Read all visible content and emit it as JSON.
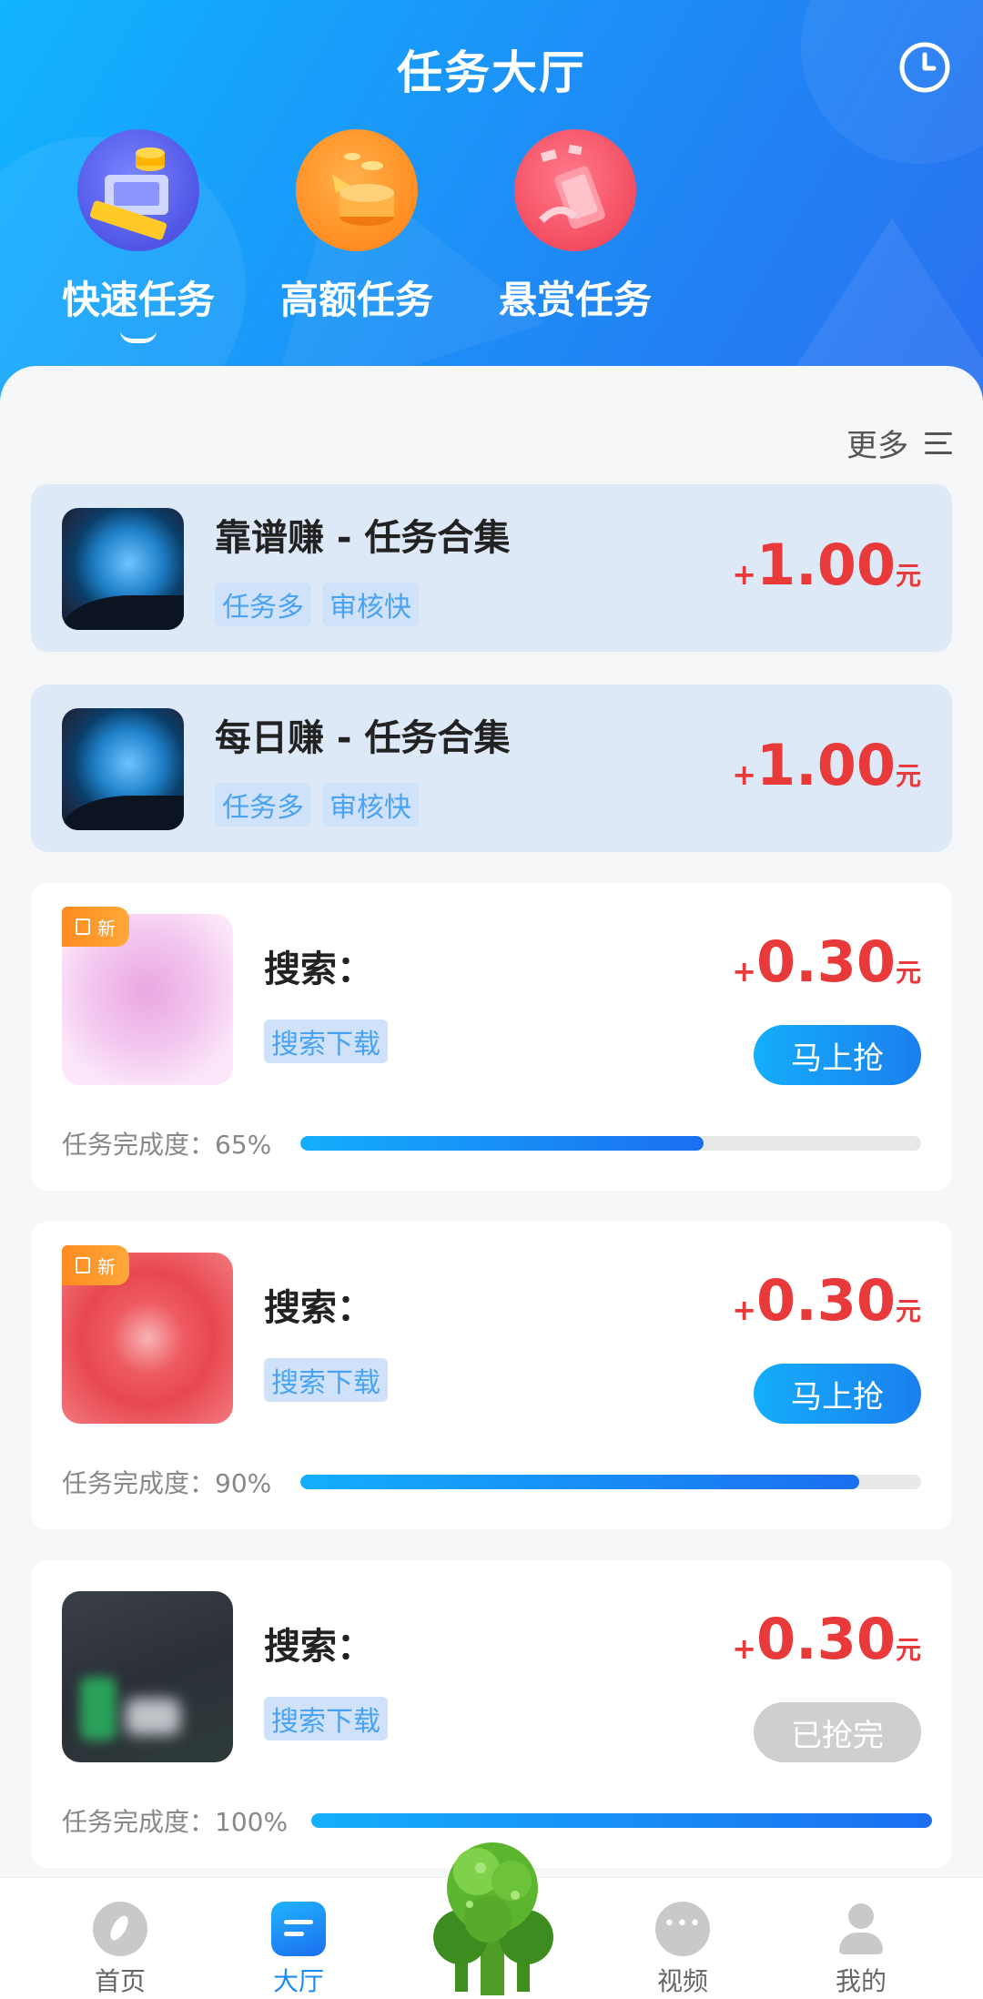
{
  "header": {
    "title": "任务大厅",
    "categories": [
      {
        "label": "快速任务",
        "icon": "money-stack-illustration",
        "active": true
      },
      {
        "label": "高额任务",
        "icon": "coins-illustration",
        "active": false
      },
      {
        "label": "悬赏任务",
        "icon": "phone-reward-illustration",
        "active": false
      }
    ]
  },
  "list": {
    "more_label": "更多"
  },
  "featured": [
    {
      "title": "靠谱赚 - 任务合集",
      "tags": [
        "任务多",
        "审核快"
      ],
      "plus": "+",
      "amount": "1.00",
      "unit": "元"
    },
    {
      "title": "每日赚 - 任务合集",
      "tags": [
        "任务多",
        "审核快"
      ],
      "plus": "+",
      "amount": "1.00",
      "unit": "元"
    }
  ],
  "tasks": [
    {
      "badge": "新",
      "title": "搜索：",
      "tag": "搜索下载",
      "plus": "+",
      "amount": "0.30",
      "unit": "元",
      "button": "马上抢",
      "progress_label": "任务完成度：65%",
      "progress": 0.65
    },
    {
      "badge": "新",
      "title": "搜索：",
      "tag": "搜索下载",
      "plus": "+",
      "amount": "0.30",
      "unit": "元",
      "button": "马上抢",
      "progress_label": "任务完成度：90%",
      "progress": 0.9
    },
    {
      "title": "搜索：",
      "tag": "搜索下载",
      "plus": "+",
      "amount": "0.30",
      "unit": "元",
      "button": "已抢完",
      "progress_label": "任务完成度：100%",
      "progress": 1.0
    }
  ],
  "nav": [
    {
      "label": "首页",
      "icon": "compass-icon"
    },
    {
      "label": "大厅",
      "icon": "hall-icon",
      "active": true
    },
    {
      "label": "视频",
      "icon": "chat-bubble-icon"
    },
    {
      "label": "我的",
      "icon": "person-icon"
    }
  ],
  "colors": {
    "accent": "#1b8cf4",
    "price": "#e83a3a",
    "header_start": "#11b4ff",
    "header_end": "#2a6ff0"
  }
}
